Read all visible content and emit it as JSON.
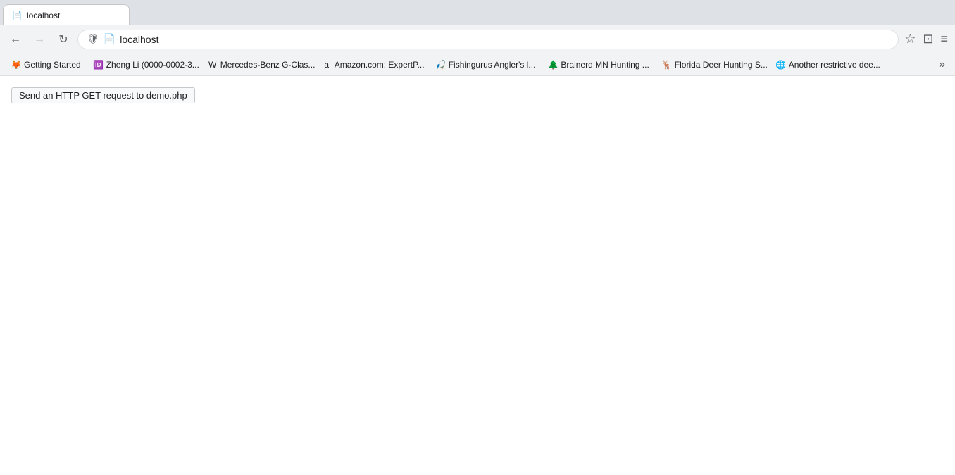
{
  "browser": {
    "tab": {
      "title": "localhost"
    },
    "nav": {
      "back_label": "←",
      "forward_label": "→",
      "refresh_label": "↻",
      "address": "localhost",
      "star_label": "☆",
      "pocket_label": "⊡",
      "menu_label": "≡"
    },
    "bookmarks": [
      {
        "id": "getting-started",
        "favicon": "🦊",
        "label": "Getting Started"
      },
      {
        "id": "zheng-li",
        "favicon": "🆔",
        "label": "Zheng Li (0000-0002-3..."
      },
      {
        "id": "mercedes",
        "favicon": "W",
        "label": "Mercedes-Benz G-Clas..."
      },
      {
        "id": "amazon",
        "favicon": "a",
        "label": "Amazon.com: ExpertP..."
      },
      {
        "id": "fishingurus",
        "favicon": "🎣",
        "label": "Fishingurus Angler's l..."
      },
      {
        "id": "brainerd",
        "favicon": "🌲",
        "label": "Brainerd MN Hunting ..."
      },
      {
        "id": "florida-deer",
        "favicon": "🦌",
        "label": "Florida Deer Hunting S..."
      },
      {
        "id": "another-restrictive",
        "favicon": "🌐",
        "label": "Another restrictive dee..."
      }
    ],
    "more_label": "»"
  },
  "page": {
    "button_label": "Send an HTTP GET request to demo.php"
  }
}
